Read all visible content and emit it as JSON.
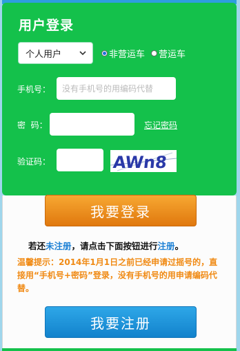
{
  "title": "用户登录",
  "user_type_select": {
    "value": "个人用户"
  },
  "vehicle_type": [
    {
      "label": "非营运车",
      "selected": true
    },
    {
      "label": "营运车",
      "selected": false
    }
  ],
  "phone": {
    "label": "手机号：",
    "placeholder": "没有手机号的用编码代替"
  },
  "password": {
    "label": "密  码：",
    "value": "",
    "forgot_link": "忘记密码"
  },
  "captcha": {
    "label": "验证码：",
    "value": "",
    "image_text": "AWn8"
  },
  "login_button": "我要登录",
  "notice": {
    "part1": "若还",
    "link1": "未注册",
    "part2": "，请点击下面按钮进行",
    "link2": "注册",
    "part3": "。"
  },
  "tip": "温馨提示：2014年1月1日之前已经申请过摇号的，直接用“手机号+密码”登录，没有手机号的用申请编码代替。",
  "register_button": "我要注册",
  "colors": {
    "panel": "#14c14b",
    "login_button": "#e8860f",
    "register_button": "#1b90d8",
    "tip_text": "#f08a14",
    "link": "#1a7fd4"
  }
}
